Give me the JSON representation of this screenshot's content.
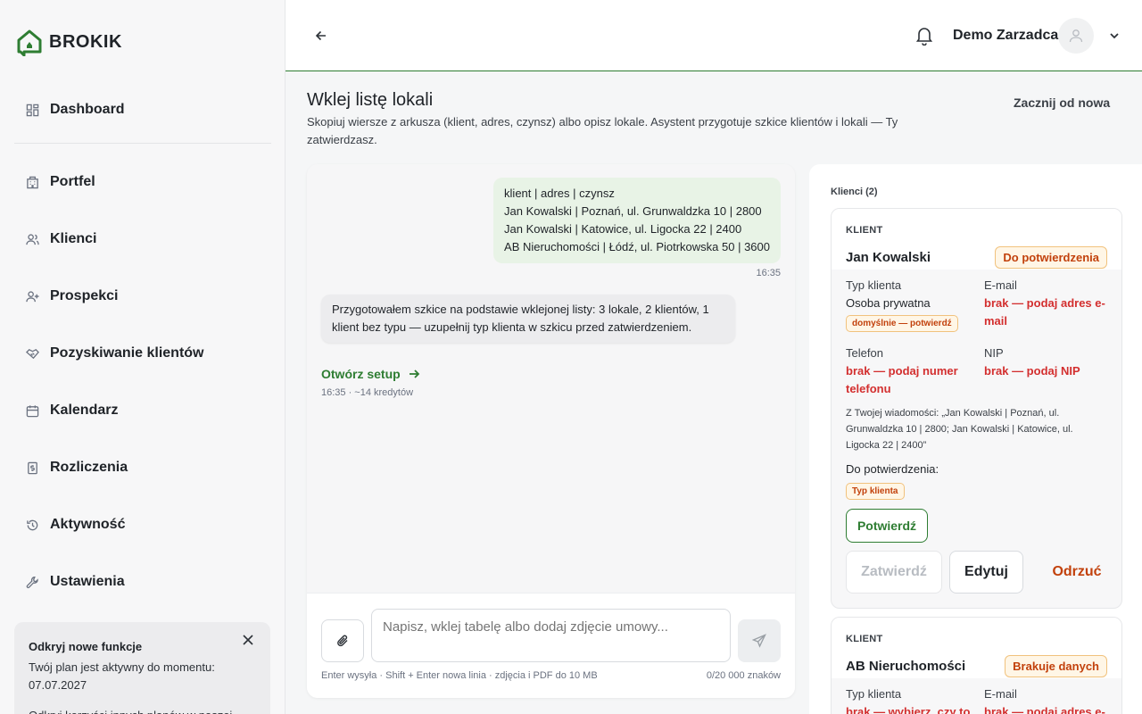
{
  "brand": {
    "name": "BROKIK",
    "accent": "#2e7d32"
  },
  "sidebar": {
    "items": [
      {
        "label": "Dashboard",
        "icon": "dashboard-icon"
      },
      {
        "label": "Portfel",
        "icon": "building-icon"
      },
      {
        "label": "Klienci",
        "icon": "users-icon"
      },
      {
        "label": "Prospekci",
        "icon": "user-plus-icon"
      },
      {
        "label": "Pozyskiwanie klientów",
        "icon": "handshake-icon"
      },
      {
        "label": "Kalendarz",
        "icon": "calendar-icon"
      },
      {
        "label": "Rozliczenia",
        "icon": "receipt-icon"
      },
      {
        "label": "Aktywność",
        "icon": "history-icon"
      },
      {
        "label": "Ustawienia",
        "icon": "wrench-icon"
      }
    ],
    "promo": {
      "title": "Odkryj nowe funkcje",
      "text": "Twój plan jest aktywny do momentu: 07.07.2027",
      "more": "Odkryj korzyści innych planów w naszej"
    }
  },
  "topbar": {
    "user_name": "Demo Zarzadca"
  },
  "page": {
    "title": "Wklej listę lokali",
    "subtitle": "Skopiuj wiersze z arkusza (klient, adres, czynsz) albo opisz lokale. Asystent przygotuje szkice klientów i lokali — Ty zatwierdzasz.",
    "restart": "Zacznij od nowa"
  },
  "chat": {
    "user_lines": [
      "klient | adres | czynsz",
      "Jan Kowalski | Poznań, ul. Grunwaldzka 10 | 2800",
      "Jan Kowalski | Katowice, ul. Ligocka 22 | 2400",
      "AB Nieruchomości | Łódź, ul. Piotrkowska 50 | 3600"
    ],
    "user_time": "16:35",
    "bot_text": "Przygotowałem szkice na podstawie wklejonej listy: 3 lokale, 2 klientów, 1 klient bez typu — uzupełnij typ klienta w szkicu przed zatwierdzeniem.",
    "setup_link": "Otwórz setup",
    "bot_meta": "16:35 · ~14 kredytów",
    "input_placeholder": "Napisz, wklej tabelę albo dodaj zdjęcie umowy...",
    "hint": "Enter wysyła · Shift + Enter nowa linia · zdjęcia i PDF do 10 MB",
    "counter": "0/20 000 znaków"
  },
  "panel": {
    "title": "Klienci (2)",
    "cards": [
      {
        "kicker": "KLIENT",
        "name": "Jan Kowalski",
        "badge": "Do potwierdzenia",
        "type_label": "Typ klienta",
        "type_value": "Osoba prywatna",
        "type_tag": "domyślnie — potwierdź",
        "email_label": "E-mail",
        "email_value": "brak — podaj adres e-mail",
        "phone_label": "Telefon",
        "phone_value": "brak — podaj numer telefonu",
        "nip_label": "NIP",
        "nip_value": "brak — podaj NIP",
        "quote": "Z Twojej wiadomości: „Jan Kowalski | Poznań, ul. Grunwaldzka 10 | 2800; Jan Kowalski | Katowice, ul. Ligocka 22 | 2400”",
        "to_confirm": "Do potwierdzenia:",
        "to_confirm_tag": "Typ klienta",
        "confirm_btn": "Potwierdź",
        "approve_btn": "Zatwierdź",
        "edit_btn": "Edytuj",
        "reject_btn": "Odrzuć"
      },
      {
        "kicker": "KLIENT",
        "name": "AB Nieruchomości",
        "badge": "Brakuje danych",
        "type_label": "Typ klienta",
        "type_value": "brak — wybierz, czy to",
        "email_label": "E-mail",
        "email_value": "brak — podaj adres e-"
      }
    ]
  }
}
